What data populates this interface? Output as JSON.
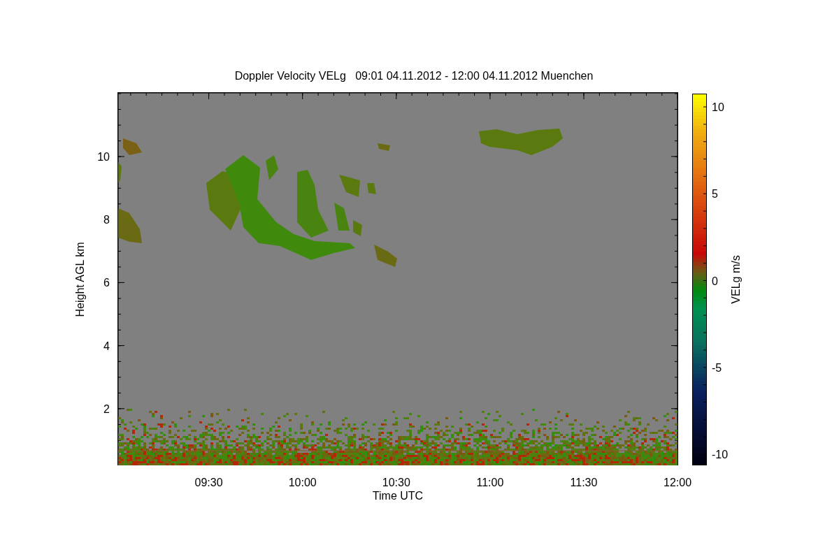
{
  "title": "Doppler Velocity VELg   09:01 04.11.2012 - 12:00 04.11.2012 Muenchen",
  "y_axis": {
    "label": "Height AGL km",
    "ticks": [
      "10",
      "8",
      "6",
      "4",
      "2"
    ]
  },
  "x_axis": {
    "label": "Time UTC",
    "ticks": [
      "09:30",
      "10:00",
      "10:30",
      "11:00",
      "11:30",
      "12:00"
    ]
  },
  "colorbar": {
    "label": "VELg m/s",
    "ticks": [
      "10",
      "5",
      "0",
      "-5",
      "-10"
    ]
  }
}
